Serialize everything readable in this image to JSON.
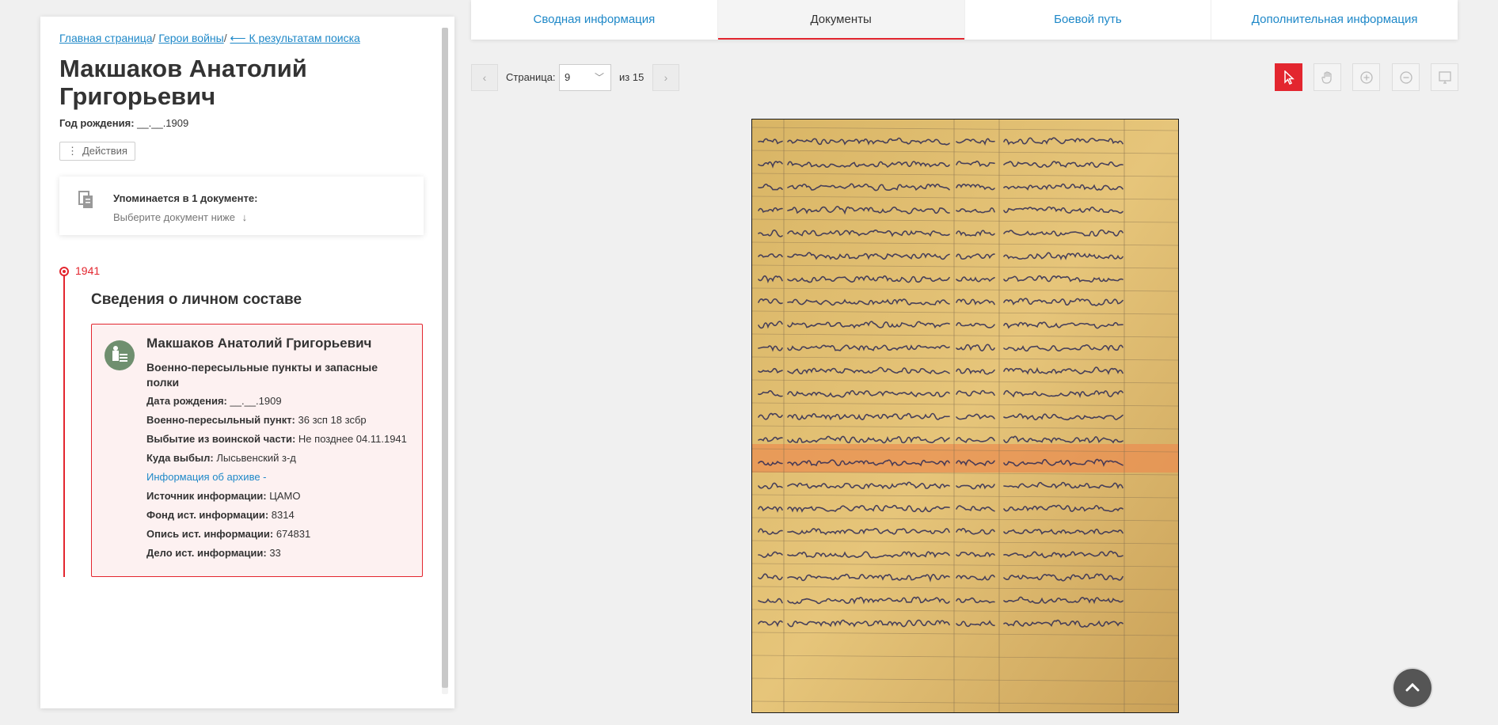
{
  "breadcrumb": {
    "home": "Главная страница",
    "sep": "/",
    "heroes": "Герои войны",
    "back": "⟵ К результатам поиска"
  },
  "person": {
    "name": "Макшаков Анатолий Григорьевич",
    "birth_label": "Год рождения:",
    "birth_value": "__.__.1909"
  },
  "actions": {
    "label": "Действия"
  },
  "mention": {
    "title": "Упоминается в 1 документе:",
    "subtitle": "Выберите документ ниже",
    "arrow": "↓"
  },
  "timeline": {
    "year": "1941",
    "section_title": "Сведения о личном составе"
  },
  "record": {
    "name": "Макшаков Анатолий Григорьевич",
    "org": "Военно-пересыльные пункты и запасные полки",
    "rows": [
      {
        "label": "Дата рождения:",
        "value": "__.__.1909"
      },
      {
        "label": "Военно-пересыльный пункт:",
        "value": "36 зсп 18 зсбр"
      },
      {
        "label": "Выбытие из воинской части:",
        "value": "Не позднее 04.11.1941"
      },
      {
        "label": "Куда выбыл:",
        "value": "Лысьвенский з-д"
      }
    ],
    "archive_link": "Информация об архиве -",
    "rows2": [
      {
        "label": "Источник информации:",
        "value": "ЦАМО"
      },
      {
        "label": "Фонд ист. информации:",
        "value": "8314"
      },
      {
        "label": "Опись ист. информации:",
        "value": "674831"
      },
      {
        "label": "Дело ист. информации:",
        "value": "33"
      }
    ]
  },
  "tabs": [
    "Сводная информация",
    "Документы",
    "Боевой путь",
    "Дополнительная информация"
  ],
  "active_tab_index": 1,
  "pager": {
    "label": "Страница:",
    "current": "9",
    "of": "из 15",
    "prev": "‹",
    "next": "›"
  },
  "colors": {
    "accent": "#e3262f",
    "link": "#1e88c8"
  }
}
